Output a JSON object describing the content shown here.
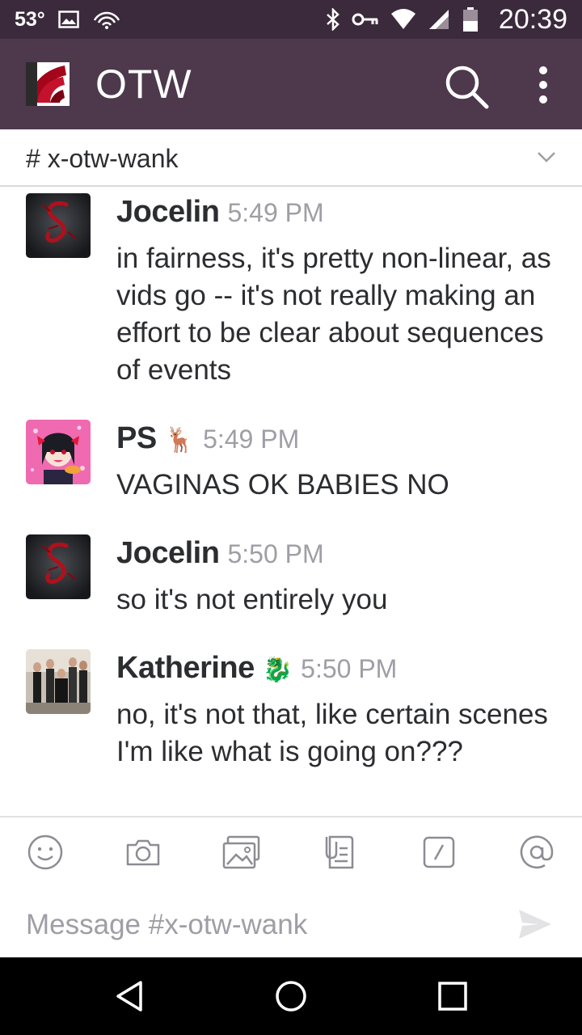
{
  "status_bar": {
    "temperature": "53°",
    "time": "20:39"
  },
  "app_bar": {
    "title": "OTW"
  },
  "channel": {
    "name": "# x-otw-wank"
  },
  "messages": [
    {
      "author": "Jocelin",
      "emoji": "",
      "time": "5:49 PM",
      "text": "in fairness, it's pretty non-linear, as vids go -- it's not really making an effort to be clear about sequences of events"
    },
    {
      "author": "PS",
      "emoji": "🦌",
      "time": "5:49 PM",
      "text": "VAGINAS OK BABIES NO"
    },
    {
      "author": "Jocelin",
      "emoji": "",
      "time": "5:50 PM",
      "text": "so it's not entirely you"
    },
    {
      "author": "Katherine",
      "emoji": "🐉",
      "time": "5:50 PM",
      "text": "no, it's not that, like certain scenes I'm like what is going on???"
    }
  ],
  "composer": {
    "placeholder": "Message #x-otw-wank",
    "tools": [
      "smiley-icon",
      "camera-icon",
      "gallery-icon",
      "file-icon",
      "slash-command-icon",
      "mention-icon"
    ]
  },
  "colors": {
    "status_bar_bg": "#3b2a3b",
    "app_bar_bg": "#4d394b",
    "text": "#2c2d30",
    "muted": "#9e9ea6"
  }
}
